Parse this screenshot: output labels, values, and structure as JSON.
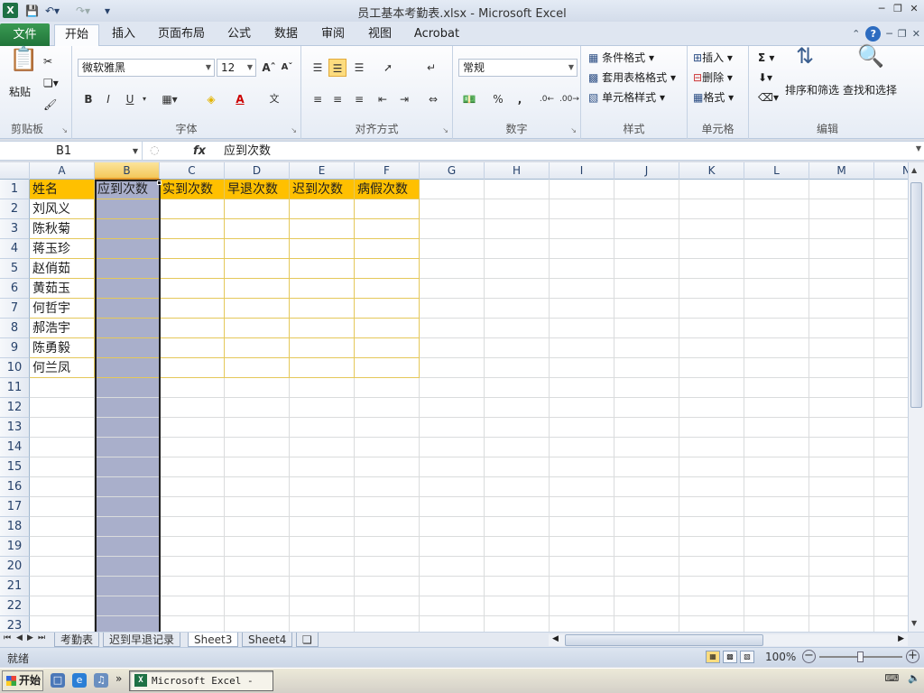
{
  "window": {
    "title": "员工基本考勤表.xlsx  -  Microsoft Excel",
    "app_icon": "X"
  },
  "quick_access": {
    "save_icon": "save-icon",
    "undo_icon": "undo-icon",
    "redo_icon": "redo-icon",
    "customize_icon": "customize-icon"
  },
  "tabs": {
    "file": "文件",
    "items": [
      "开始",
      "插入",
      "页面布局",
      "公式",
      "数据",
      "审阅",
      "视图",
      "Acrobat"
    ],
    "active": "开始"
  },
  "ribbon": {
    "clipboard": {
      "label": "剪贴板",
      "paste": "粘贴"
    },
    "font": {
      "label": "字体",
      "name": "微软雅黑",
      "size": "12"
    },
    "alignment": {
      "label": "对齐方式"
    },
    "number": {
      "label": "数字",
      "format": "常规",
      "percent": "%",
      "comma": ","
    },
    "styles": {
      "label": "样式",
      "conditional": "条件格式",
      "table": "套用表格格式",
      "cell": "单元格样式"
    },
    "cells": {
      "label": "单元格",
      "insert": "插入",
      "delete": "删除",
      "format": "格式"
    },
    "editing": {
      "label": "编辑",
      "sort": "排序和筛选",
      "find": "查找和选择",
      "sigma": "Σ"
    }
  },
  "formula_bar": {
    "name_box": "B1",
    "fx": "fx",
    "value": "应到次数"
  },
  "columns": [
    "A",
    "B",
    "C",
    "D",
    "E",
    "F",
    "G",
    "H",
    "I",
    "J",
    "K",
    "L",
    "M",
    "N"
  ],
  "rows": [
    "1",
    "2",
    "3",
    "4",
    "5",
    "6",
    "7",
    "8",
    "9",
    "10",
    "11",
    "12",
    "13",
    "14",
    "15",
    "16",
    "17",
    "18",
    "19",
    "20",
    "21",
    "22",
    "23"
  ],
  "headers": [
    "姓名",
    "应到次数",
    "实到次数",
    "早退次数",
    "迟到次数",
    "病假次数"
  ],
  "names": [
    "刘风义",
    "陈秋菊",
    "蒋玉珍",
    "赵俏茹",
    "黄茹玉",
    "何哲宇",
    "郝浩宇",
    "陈勇毅",
    "何兰凤"
  ],
  "sheets": [
    "考勤表",
    "迟到早退记录",
    "Sheet3",
    "Sheet4"
  ],
  "active_sheet": "Sheet3",
  "status": {
    "text": "就绪",
    "zoom": "100%",
    "zoom_level": 1.0
  },
  "taskbar": {
    "start": "开始",
    "task": "Microsoft Excel - ..."
  },
  "colors": {
    "header_fill": "#ffc000",
    "selection_fill": "#a9afcb",
    "file_tab": "#20743a"
  }
}
